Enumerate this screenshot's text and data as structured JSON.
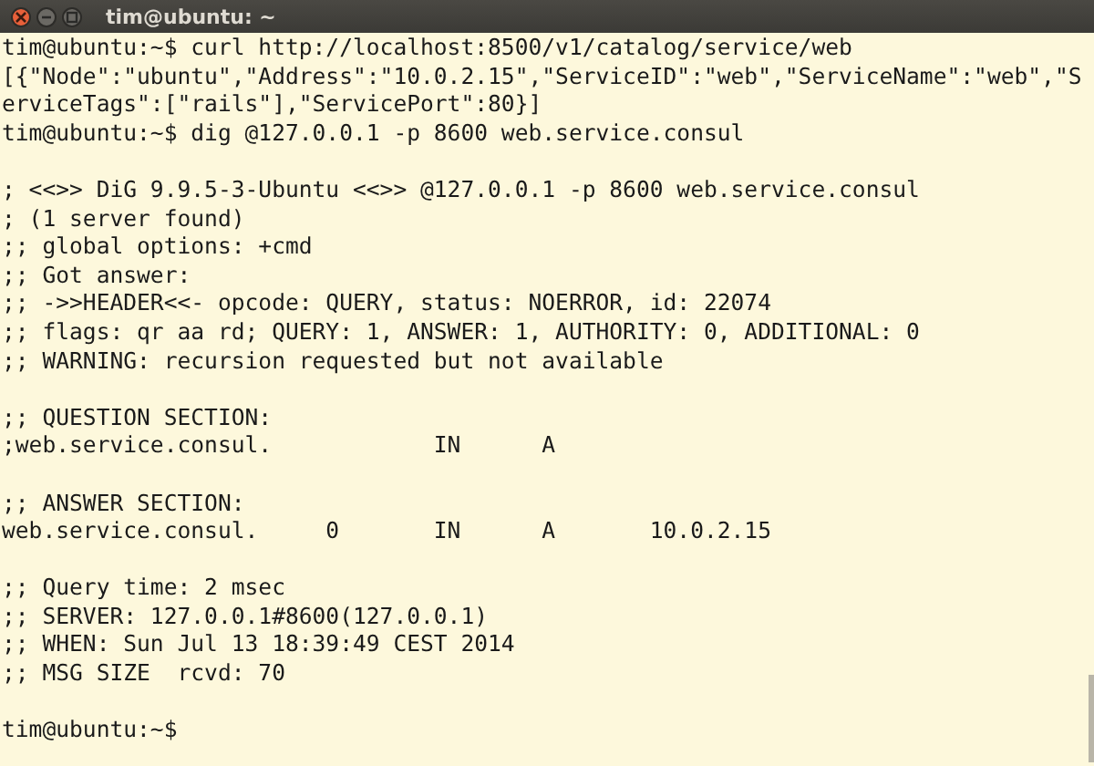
{
  "window": {
    "title": "tim@ubuntu: ~"
  },
  "blocks": [
    [
      "tim@ubuntu:~$ curl http://localhost:8500/v1/catalog/service/web",
      "[{\"Node\":\"ubuntu\",\"Address\":\"10.0.2.15\",\"ServiceID\":\"web\",\"ServiceName\":\"web\",\"S",
      "erviceTags\":[\"rails\"],\"ServicePort\":80}]",
      "tim@ubuntu:~$ dig @127.0.0.1 -p 8600 web.service.consul"
    ],
    [
      "; <<>> DiG 9.9.5-3-Ubuntu <<>> @127.0.0.1 -p 8600 web.service.consul",
      "; (1 server found)",
      ";; global options: +cmd",
      ";; Got answer:",
      ";; ->>HEADER<<- opcode: QUERY, status: NOERROR, id: 22074",
      ";; flags: qr aa rd; QUERY: 1, ANSWER: 1, AUTHORITY: 0, ADDITIONAL: 0",
      ";; WARNING: recursion requested but not available"
    ],
    [
      ";; QUESTION SECTION:",
      ";web.service.consul.            IN      A"
    ],
    [
      ";; ANSWER SECTION:",
      "web.service.consul.     0       IN      A       10.0.2.15"
    ],
    [
      ";; Query time: 2 msec",
      ";; SERVER: 127.0.0.1#8600(127.0.0.1)",
      ";; WHEN: Sun Jul 13 18:39:49 CEST 2014",
      ";; MSG SIZE  rcvd: 70"
    ],
    [
      "tim@ubuntu:~$"
    ]
  ]
}
